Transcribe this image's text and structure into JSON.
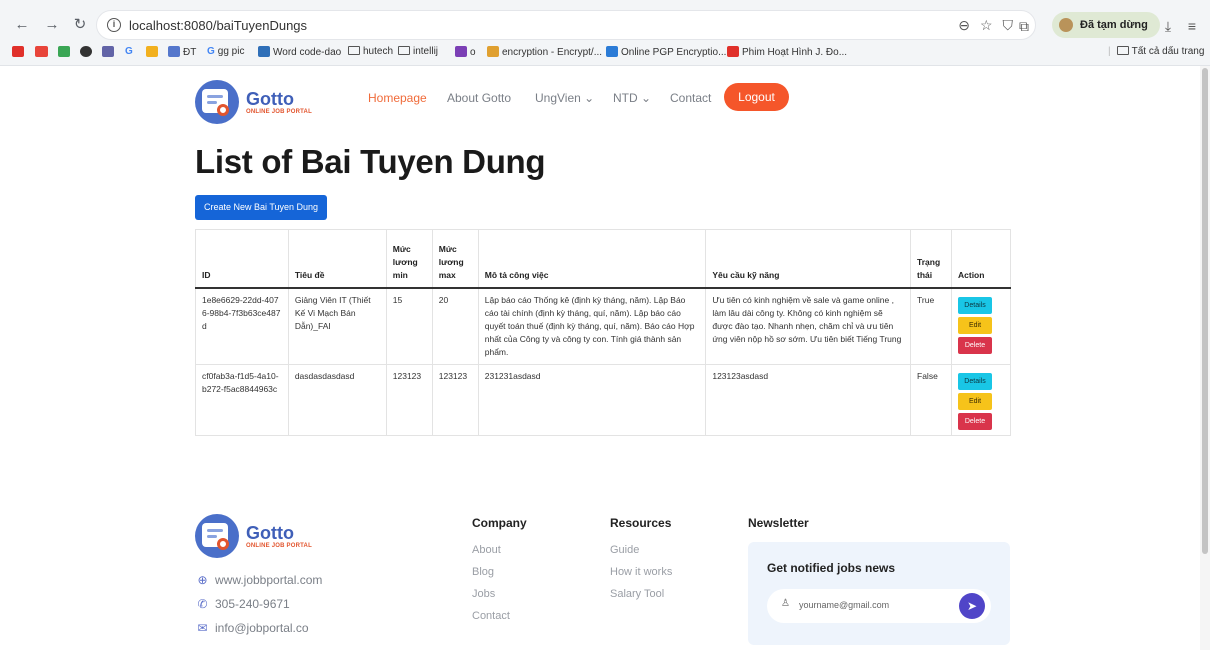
{
  "browser": {
    "url": "localhost:8080/baiTuyenDungs",
    "paused_label": "Đã tạm dừng",
    "bookmarks": [
      {
        "label": "ĐT",
        "color": "#5577cc"
      },
      {
        "label": "gg pic",
        "color": "#4285f4"
      },
      {
        "label": "Word code-dao",
        "color": "#2f6fb8"
      },
      {
        "label": "hutech",
        "color": ""
      },
      {
        "label": "intellij",
        "color": ""
      },
      {
        "label": "o",
        "color": "#7b3fb5"
      },
      {
        "label": "encryption - Encrypt/...",
        "color": "#e0a030"
      },
      {
        "label": "Online PGP Encryptio...",
        "color": "#2b7bd6"
      },
      {
        "label": "Phim Hoạt Hình J. Đo...",
        "color": "#e0302a"
      }
    ],
    "all_bookmarks_label": "Tất cả dấu trang"
  },
  "brand": {
    "name": "Gotto",
    "tagline": "ONLINE JOB PORTAL",
    "primary_color": "#3f5fb8",
    "accent_color": "#f5562a"
  },
  "nav": {
    "homepage": "Homepage",
    "about": "About Gotto",
    "ungvien": "UngVien ⌄",
    "ntd": "NTD ⌄",
    "contact": "Contact",
    "logout": "Logout"
  },
  "page": {
    "title": "List of Bai Tuyen Dung",
    "create_button": "Create New Bai Tuyen Dung"
  },
  "table": {
    "headers": [
      "ID",
      "Tiêu đề",
      "Mức lương min",
      "Mức lương max",
      "Mô tả công việc",
      "Yêu cầu kỹ năng",
      "Trạng thái",
      "Action"
    ],
    "rows": [
      {
        "id": "1e8e6629-22dd-4076-98b4-7f3b63ce487d",
        "title": "Giảng Viên IT (Thiết Kế Vi Mạch Bán Dẫn)_FAI",
        "min": "15",
        "max": "20",
        "description": "Lập báo cáo Thống kê (định kỳ tháng, năm). Lập Báo cáo tài chính (định kỳ tháng, quí, năm). Lập báo cáo quyết toán thuế (định kỳ tháng, quí, năm). Báo cáo Hợp nhất của Công ty và công ty con. Tính giá thành sản phẩm.",
        "skills": "Ưu tiên có kinh nghiệm về sale và game online , làm lâu dài công ty. Không có kinh nghiệm sẽ được đào tạo. Nhanh nhẹn, chăm chỉ và ưu tiên ứng viên nộp hồ sơ sớm. Ưu tiên biết Tiếng Trung",
        "status": "True"
      },
      {
        "id": "cf0fab3a-f1d5-4a10-b272-f5ac8844963c",
        "title": "dasdasdasdasd",
        "min": "123123",
        "max": "123123",
        "description": "231231asdasd",
        "skills": "123123asdasd",
        "status": "False"
      }
    ],
    "actions": {
      "details": "Details",
      "edit": "Edit",
      "delete": "Delete"
    }
  },
  "footer": {
    "website": "www.jobbportal.com",
    "phone": "305-240-9671",
    "email": "info@jobportal.co",
    "company_title": "Company",
    "company_links": [
      "About",
      "Blog",
      "Jobs",
      "Contact"
    ],
    "resources_title": "Resources",
    "resources_links": [
      "Guide",
      "How it works",
      "Salary Tool"
    ],
    "newsletter_title": "Newsletter",
    "newsletter_heading": "Get notified jobs news",
    "newsletter_placeholder": "yourname@gmail.com"
  }
}
